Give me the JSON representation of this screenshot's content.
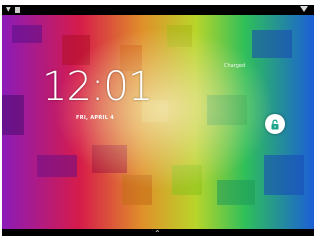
{
  "status_bar": {
    "left_icons": [
      "notification-icon",
      "sd-card-icon"
    ],
    "right_icons": [
      "wifi-icon"
    ]
  },
  "lockscreen": {
    "time": "12:01",
    "date": "FRI, APRIL 4",
    "battery_status": "Charged",
    "unlock_icon": "unlock-icon",
    "accent": "#1aa58b"
  },
  "nav": {
    "expand_icon": "chevron-up-icon"
  }
}
